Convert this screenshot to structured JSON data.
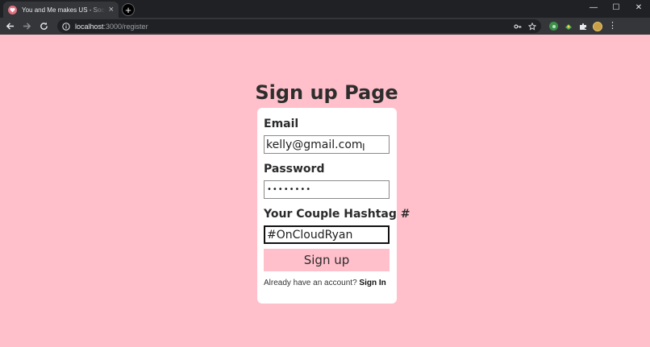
{
  "browser": {
    "tab_title": "You and Me makes US - Social N",
    "tab_close": "×",
    "new_tab": "+",
    "url_host": "localhost",
    "url_path": ":3000/register",
    "window_controls": {
      "minimize": "—",
      "maximize": "☐",
      "close": "✕"
    }
  },
  "page": {
    "title": "Sign up Page",
    "email": {
      "label": "Email",
      "value": "kelly@gmail.com"
    },
    "password": {
      "label": "Password",
      "masked_value": "••••••••"
    },
    "hashtag": {
      "label": "Your Couple Hashtag #",
      "value": "#OnCloudRyan"
    },
    "submit_label": "Sign up",
    "footer": {
      "prompt": "Already have an account? ",
      "link": "Sign In"
    }
  },
  "colors": {
    "page_background": "#ffc0cb",
    "card_background": "#ffffff",
    "button_background": "#ffc0cb",
    "chrome_dark": "#202124",
    "chrome_toolbar": "#35363a"
  },
  "icons": [
    "heart-favicon-icon",
    "close-icon",
    "plus-icon",
    "back-arrow-icon",
    "forward-arrow-icon",
    "reload-icon",
    "info-icon",
    "key-icon",
    "star-icon",
    "extension-icon",
    "puzzle-icon",
    "avatar",
    "menu-dots-icon",
    "text-cursor-icon"
  ]
}
